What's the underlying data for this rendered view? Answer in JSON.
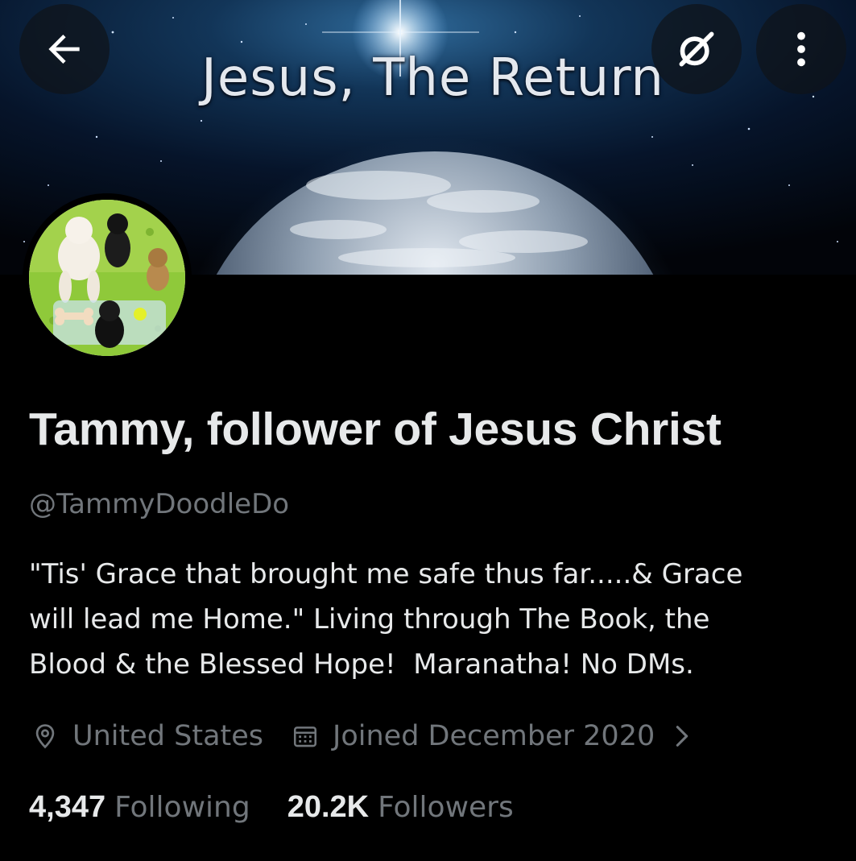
{
  "header": {
    "banner_title": "Jesus, The Return",
    "back_icon": "arrow-left-icon",
    "grok_icon": "grok-icon",
    "more_icon": "more-vertical-icon"
  },
  "profile": {
    "display_name": "Tammy, follower of Jesus Christ",
    "handle": "@TammyDoodleDo",
    "bio_lines": [
      "\"Tis' Grace that brought me safe thus far.....& Grace",
      "will lead me Home.\" Living through The Book, the",
      "Blood & the Blessed Hope!  Maranatha! No DMs."
    ],
    "location": "United States",
    "location_icon": "location-pin-icon",
    "joined": "Joined December 2020",
    "joined_icon": "calendar-icon",
    "joined_chevron_icon": "chevron-right-icon"
  },
  "stats": {
    "following_count": "4,347",
    "following_label": "Following",
    "followers_count": "20.2K",
    "followers_label": "Followers"
  },
  "colors": {
    "background": "#000000",
    "primary_text": "#e7e9ea",
    "secondary_text": "#71767b"
  }
}
